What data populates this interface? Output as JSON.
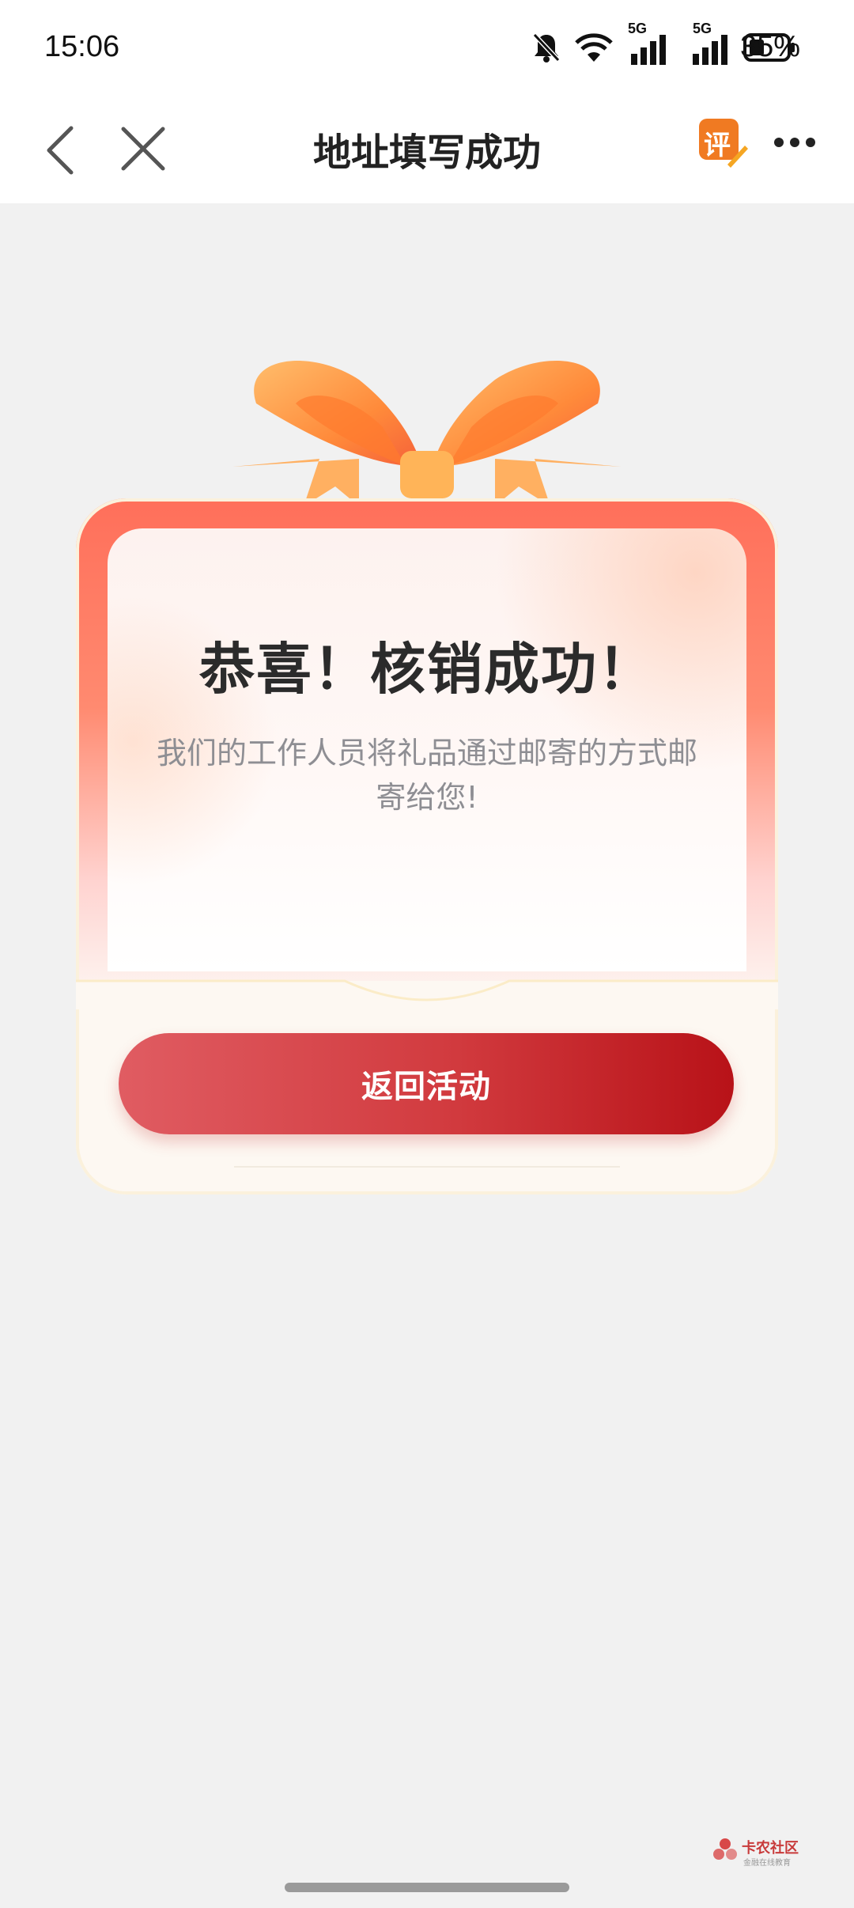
{
  "status_bar": {
    "time": "15:06",
    "network_1": "5G",
    "network_2": "5G",
    "battery": "35%",
    "icons": [
      "mute-icon",
      "wifi-icon",
      "signal-icon",
      "signal-icon",
      "battery-icon"
    ]
  },
  "nav": {
    "title": "地址填写成功",
    "review_badge": "评",
    "icons": [
      "back-icon",
      "close-icon",
      "review-icon",
      "more-icon"
    ]
  },
  "card": {
    "title": "恭喜！核销成功！",
    "description": "我们的工作人员将礼品通过邮寄的方式邮寄给您!",
    "button_label": "返回活动"
  },
  "watermark": {
    "brand": "卡农社区",
    "tagline": "金融在线教育"
  },
  "colors": {
    "accent": "#c8161d",
    "card_top": "#ff6f5a",
    "background": "#f1f1f1"
  }
}
